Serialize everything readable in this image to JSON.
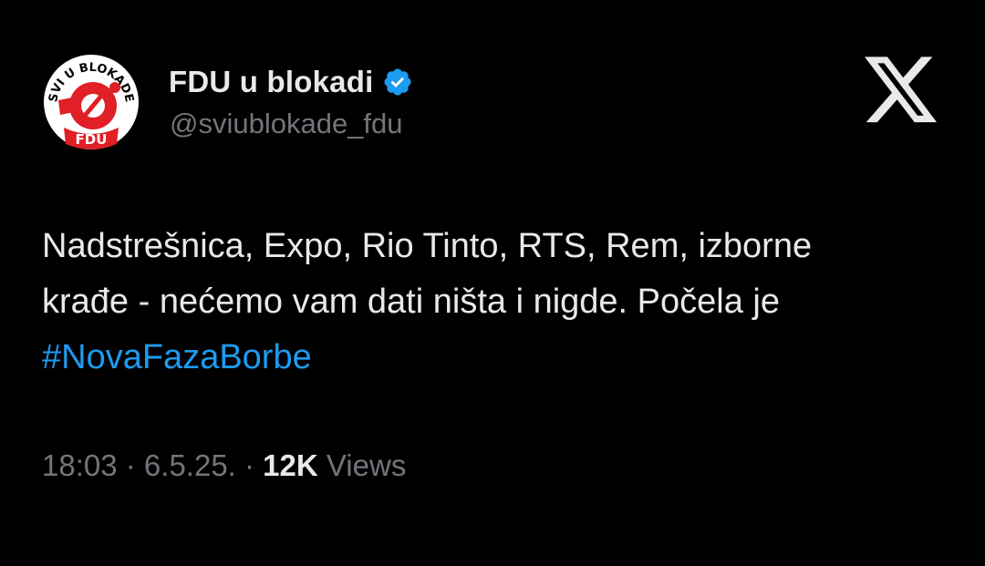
{
  "colors": {
    "background": "#000000",
    "text_primary": "#e7e9ea",
    "text_secondary": "#71767b",
    "link": "#1d9bf0",
    "verified": "#1d9bf0",
    "avatar_red": "#e01f26"
  },
  "author": {
    "display_name": "FDU u blokadi",
    "handle": "@sviublokade_fdu",
    "verified_icon": "verified-badge-icon",
    "avatar": {
      "top_text": "SVI U BLOKADE",
      "bottom_text": "FDU"
    }
  },
  "platform_logo": "x-logo-icon",
  "tweet": {
    "lines": [
      "Nadstrešnica, Expo, Rio Tinto, RTS, Rem, izborne",
      "krađe - nećemo vam dati ništa i nigde. Počela je"
    ],
    "hashtag": "#NovaFazaBorbe"
  },
  "meta": {
    "time": "18:03",
    "separator": " · ",
    "date": "6.5.25.",
    "views_count": "12K",
    "views_label": "Views"
  }
}
